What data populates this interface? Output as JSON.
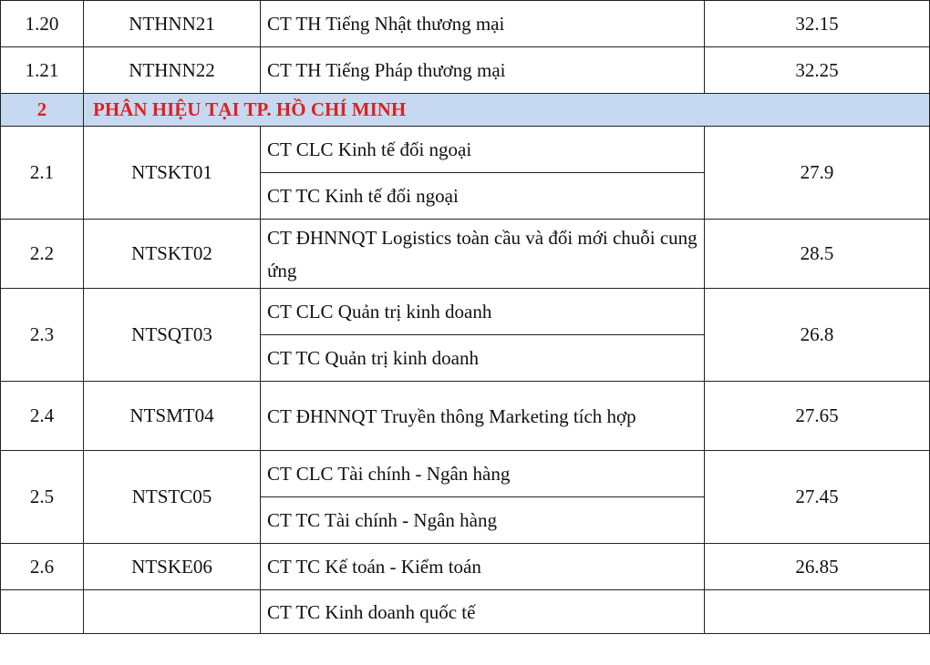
{
  "rows_top": [
    {
      "stt": "1.20",
      "code": "NTHNN21",
      "program": "CT TH Tiếng Nhật thương mại",
      "score": "32.15"
    },
    {
      "stt": "1.21",
      "code": "NTHNN22",
      "program": "CT TH Tiếng Pháp thương mại",
      "score": "32.25"
    }
  ],
  "section": {
    "number": "2",
    "title": "PHÂN HIỆU TẠI TP. HỒ CHÍ MINH"
  },
  "groups": [
    {
      "stt": "2.1",
      "code": "NTSKT01",
      "programs": [
        "CT CLC Kinh tế đối ngoại",
        "CT TC Kinh tế đối ngoại"
      ],
      "score": "27.9"
    },
    {
      "stt": "2.2",
      "code": "NTSKT02",
      "programs": [
        "CT ĐHNNQT Logistics toàn cầu và đổi mới chuỗi cung ứng"
      ],
      "score": "28.5"
    },
    {
      "stt": "2.3",
      "code": "NTSQT03",
      "programs": [
        "CT CLC Quản trị kinh doanh",
        "CT TC Quản trị kinh doanh"
      ],
      "score": "26.8"
    },
    {
      "stt": "2.4",
      "code": "NTSMT04",
      "programs": [
        "CT ĐHNNQT Truyền thông Marketing tích hợp"
      ],
      "score": "27.65"
    },
    {
      "stt": "2.5",
      "code": "NTSTC05",
      "programs": [
        "CT CLC Tài chính - Ngân hàng",
        "CT TC Tài chính - Ngân hàng"
      ],
      "score": "27.45"
    },
    {
      "stt": "2.6",
      "code": "NTSKE06",
      "programs": [
        "CT TC Kế toán - Kiểm toán"
      ],
      "score": "26.85"
    },
    {
      "stt": "",
      "code": "",
      "programs": [
        "CT TC Kinh doanh quốc tế"
      ],
      "score": ""
    }
  ]
}
